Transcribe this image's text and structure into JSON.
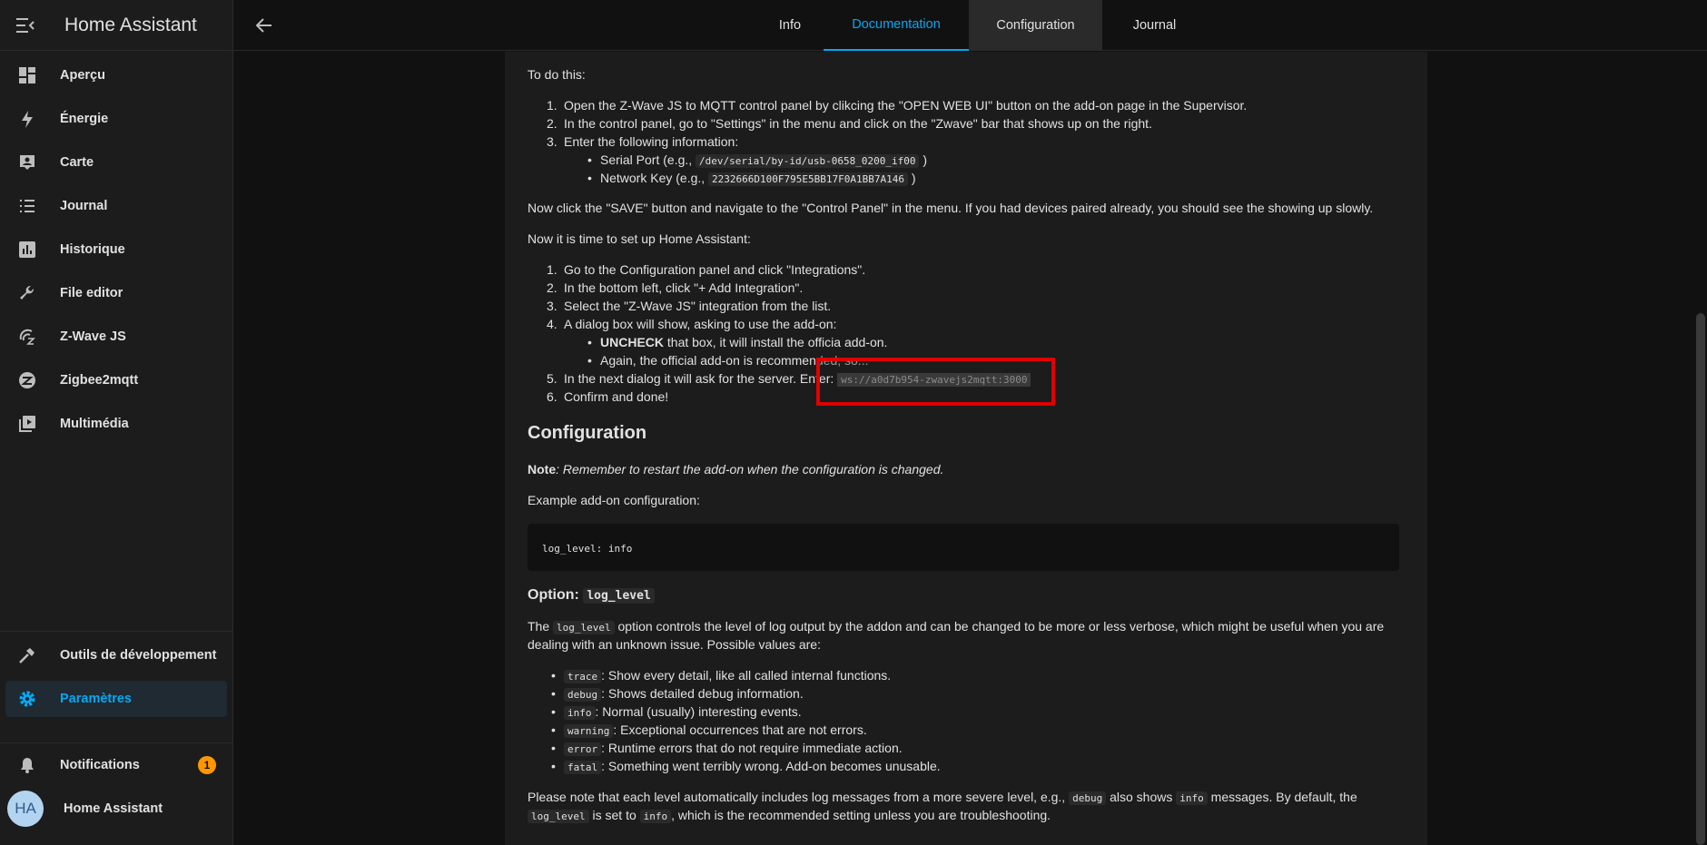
{
  "app": {
    "title": "Home Assistant"
  },
  "sidebar": {
    "items": [
      {
        "label": "Aperçu",
        "icon": "dashboard-icon"
      },
      {
        "label": "Énergie",
        "icon": "lightning-icon"
      },
      {
        "label": "Carte",
        "icon": "map-account-icon"
      },
      {
        "label": "Journal",
        "icon": "list-icon"
      },
      {
        "label": "Historique",
        "icon": "chart-box-icon"
      },
      {
        "label": "File editor",
        "icon": "wrench-icon"
      },
      {
        "label": "Z-Wave JS",
        "icon": "zwave-icon"
      },
      {
        "label": "Zigbee2mqtt",
        "icon": "zigbee-icon"
      },
      {
        "label": "Multimédia",
        "icon": "play-box-icon"
      }
    ],
    "dev_tools": "Outils de développement",
    "settings": "Paramètres",
    "notifications": "Notifications",
    "notifications_count": "1",
    "user": "Home Assistant",
    "user_initials": "HA"
  },
  "tabs": [
    {
      "label": "Info"
    },
    {
      "label": "Documentation"
    },
    {
      "label": "Configuration"
    },
    {
      "label": "Journal"
    }
  ],
  "doc": {
    "todo": "To do this:",
    "steps1": [
      "Open the Z-Wave JS to MQTT control panel by clikcing the \"OPEN WEB UI\" button on the add-on page in the Supervisor.",
      "In the control panel, go to \"Settings\" in the menu and click on the \"Zwave\" bar that shows up on the right.",
      "Enter the following information:"
    ],
    "serial_label": "Serial Port (e.g.,",
    "serial_code": "/dev/serial/by-id/usb-0658_0200_if00",
    "network_label": "Network Key (e.g.,",
    "network_code": "2232666D100F795E5BB17F0A1BB7A146",
    "close_paren": ")",
    "now_save": "Now click the \"SAVE\" button and navigate to the \"Control Panel\" in the menu. If you had devices paired already, you should see the showing up slowly.",
    "now_setup": "Now it is time to set up Home Assistant:",
    "steps2": [
      "Go to the Configuration panel and click \"Integrations\".",
      "In the bottom left, click \"+ Add Integration\".",
      "Select the \"Z-Wave JS\" integration from the list.",
      "A dialog box will show, asking to use the add-on:"
    ],
    "uncheck_bold": "UNCHECK",
    "uncheck_rest": " that box, it will install the officia add-on.",
    "again": "Again, the official add-on is recommen",
    "again_tail": "ded, so...",
    "step5_label": "In the next dialog it will ask for the server. En",
    "step5_label_tail": "ter:",
    "step5_code": "ws://a0d7b954-zwavejs2mqtt:3000",
    "step6": "Confirm and done!",
    "config_heading": "Configuration",
    "note_bold": "Note",
    "note_rest": ": Remember to restart the add-on when the configuration is changed.",
    "example": "Example add-on configuration:",
    "config_code": "log_level: info",
    "option_label": "Option:",
    "option_code": "log_level",
    "the": "The",
    "desc_code": "log_level",
    "desc_rest": "option controls the level of log output by the addon and can be changed to be more or less verbose, which might be useful when you are",
    "desc_line2": "dealing with an unknown issue. Possible values are:",
    "levels": [
      {
        "code": "trace",
        "text": ": Show every detail, like all called internal functions."
      },
      {
        "code": "debug",
        "text": ": Shows detailed debug information."
      },
      {
        "code": "info",
        "text": ": Normal (usually) interesting events."
      },
      {
        "code": "warning",
        "text": ": Exceptional occurrences that are not errors."
      },
      {
        "code": "error",
        "text": ": Runtime errors that do not require immediate action."
      },
      {
        "code": "fatal",
        "text": ": Something went terribly wrong. Add-on becomes unusable."
      }
    ],
    "final_a": "Please note that each level automatically includes log messages from a more severe level, e.g.,",
    "final_code1": "debug",
    "final_b": "also shows",
    "final_code2": "info",
    "final_c": "messages. By default, the",
    "final_code3": "log_level",
    "final_d": "is set to",
    "final_code4": "info",
    "final_e": ", which is the recommended setting unless you are troubleshooting."
  },
  "colors": {
    "accent": "#03a9f4",
    "highlight": "#e00000",
    "badge": "#ff9800"
  }
}
